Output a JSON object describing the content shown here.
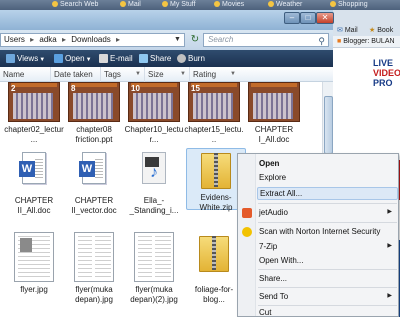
{
  "browser_toolbar": {
    "items": [
      "Search Web",
      "Mail",
      "My Stuff",
      "Movies",
      "Weather",
      "Shopping"
    ]
  },
  "address": {
    "segments": [
      "Users",
      "adka",
      "Downloads"
    ],
    "separator": "▸",
    "search_placeholder": "Search"
  },
  "commands": [
    {
      "label": "Views",
      "color": "#6fa8dc"
    },
    {
      "label": "Open",
      "color": "#5aa0e0"
    },
    {
      "label": "E-mail",
      "color": "#d9d9d9"
    },
    {
      "label": "Share",
      "color": "#8fc8f0"
    },
    {
      "label": "Burn",
      "color": "#c0c0c0"
    }
  ],
  "columns": [
    "Name",
    "Date taken",
    "Tags",
    "Size",
    "Rating"
  ],
  "files": [
    {
      "name": "chapter02_lectur...",
      "kind": "ppt",
      "badge": "2"
    },
    {
      "name": "chapter08 friction.ppt",
      "kind": "ppt",
      "badge": "8"
    },
    {
      "name": "Chapter10_lectur...",
      "kind": "ppt",
      "badge": "10"
    },
    {
      "name": "chapter15_lectu...",
      "kind": "ppt",
      "badge": "15"
    },
    {
      "name": "CHAPTER I_All.doc",
      "kind": "ppt",
      "badge": ""
    },
    {
      "name": "CHAPTER II_All.doc",
      "kind": "doc"
    },
    {
      "name": "CHAPTER II_vector.doc",
      "kind": "doc"
    },
    {
      "name": "Ella_-_Standing_i...",
      "kind": "audio"
    },
    {
      "name": "Evidens-White.zip",
      "kind": "zip"
    },
    {
      "name": "flyer.jpg",
      "kind": "jpg"
    },
    {
      "name": "flyer(muka depan).jpg",
      "kind": "jpg2"
    },
    {
      "name": "flyer(muka depan)(2).jpg",
      "kind": "jpg2"
    },
    {
      "name": "foliage-for-blog...",
      "kind": "zip"
    }
  ],
  "context_menu": {
    "items": [
      "Open",
      "Explore",
      "Extract All...",
      "jetAudio",
      "Scan with Norton Internet Security",
      "7-Zip",
      "Open With...",
      "Share...",
      "Send To",
      "Cut"
    ],
    "highlighted": "Extract All..."
  },
  "background_page": {
    "tab_mail": "Mail",
    "tab_book": "Book",
    "bookmark": "Blogger: BULAN",
    "ad_lines": [
      "LIVE",
      "VIDEO",
      "PRO"
    ],
    "banner_text": "Yo",
    "ad2_lines": [
      "W",
      "V"
    ]
  },
  "colors": {
    "window_chrome": "#b8d2ea",
    "command_bar": "#1b3150",
    "menu_highlight": "#dce8f6",
    "close_button": "#c4412a"
  }
}
